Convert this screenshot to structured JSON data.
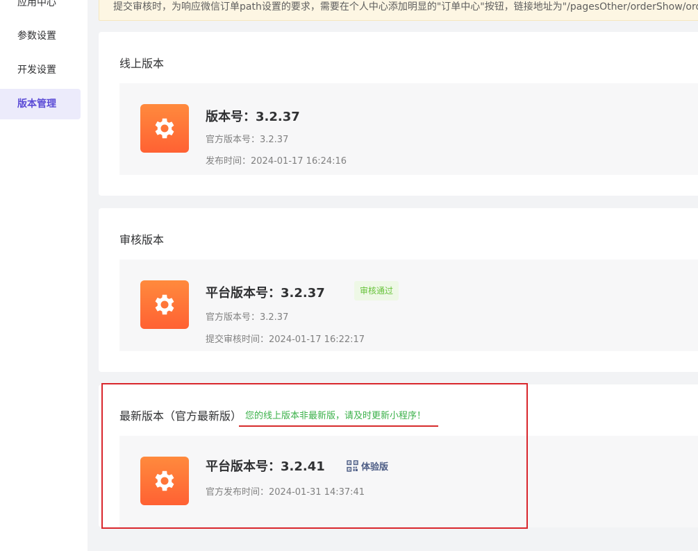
{
  "sidebar": {
    "items": [
      {
        "label": "应用中心",
        "active": false
      },
      {
        "label": "参数设置",
        "active": false
      },
      {
        "label": "开发设置",
        "active": false
      },
      {
        "label": "版本管理",
        "active": true
      }
    ]
  },
  "notice": {
    "text": "提交审核时，为响应微信订单path设置的要求，需要在个人中心添加明显的\"订单中心\"按钮，链接地址为\"/pagesOther/orderShow/orderS"
  },
  "online": {
    "title": "线上版本",
    "version_title": "版本号：3.2.37",
    "official_version": "官方版本号：3.2.37",
    "release_time": "发布时间：2024-01-17 16:24:16"
  },
  "review": {
    "title": "审核版本",
    "version_title": "平台版本号：3.2.37",
    "status_badge": "审核通过",
    "official_version": "官方版本号：3.2.37",
    "submit_time": "提交审核时间：2024-01-17 16:22:17"
  },
  "latest": {
    "title": "最新版本（官方最新版）",
    "warning": "您的线上版本非最新版，请及时更新小程序！",
    "version_title": "平台版本号：3.2.41",
    "experience_label": "体验版",
    "official_release_time": "官方发布时间：2024-01-31 14:37:41"
  },
  "colors": {
    "accent": "#5b4bd6",
    "icon_gradient_top": "#ff8a3d",
    "icon_gradient_bottom": "#ff6133",
    "success": "#67c23a",
    "warning_text": "#3bb14a",
    "highlight_border": "#d9262c"
  },
  "icons": {
    "app_icon": "gear-icon",
    "experience_icon": "qrcode-icon"
  }
}
